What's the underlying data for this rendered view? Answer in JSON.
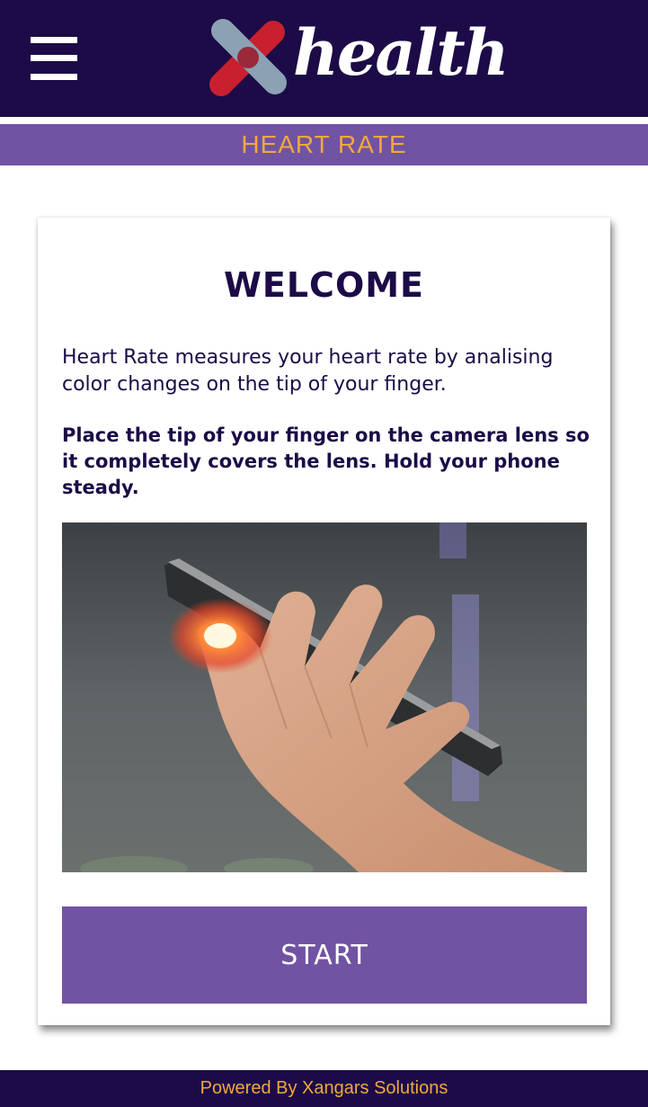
{
  "header": {
    "menu_icon": "hamburger-menu-icon",
    "logo_text": "health",
    "logo_colors": {
      "mark_red": "#c8202f",
      "mark_blue": "#8aa2b4",
      "background": "#1c0b47"
    }
  },
  "section": {
    "title": "HEART RATE"
  },
  "card": {
    "title": "WELCOME",
    "intro": "Heart Rate measures your heart rate by analising color changes on the tip of your finger.",
    "instructions": "Place the tip of your finger on the camera lens so it completely covers the lens. Hold your phone steady.",
    "image_subject": "hand-holding-phone-finger-on-camera",
    "start_label": "START"
  },
  "footer": {
    "text": "Powered By Xangars Solutions"
  },
  "colors": {
    "primary_dark": "#1c0b47",
    "accent_purple": "#7153a3",
    "accent_orange": "#f0a93a"
  }
}
